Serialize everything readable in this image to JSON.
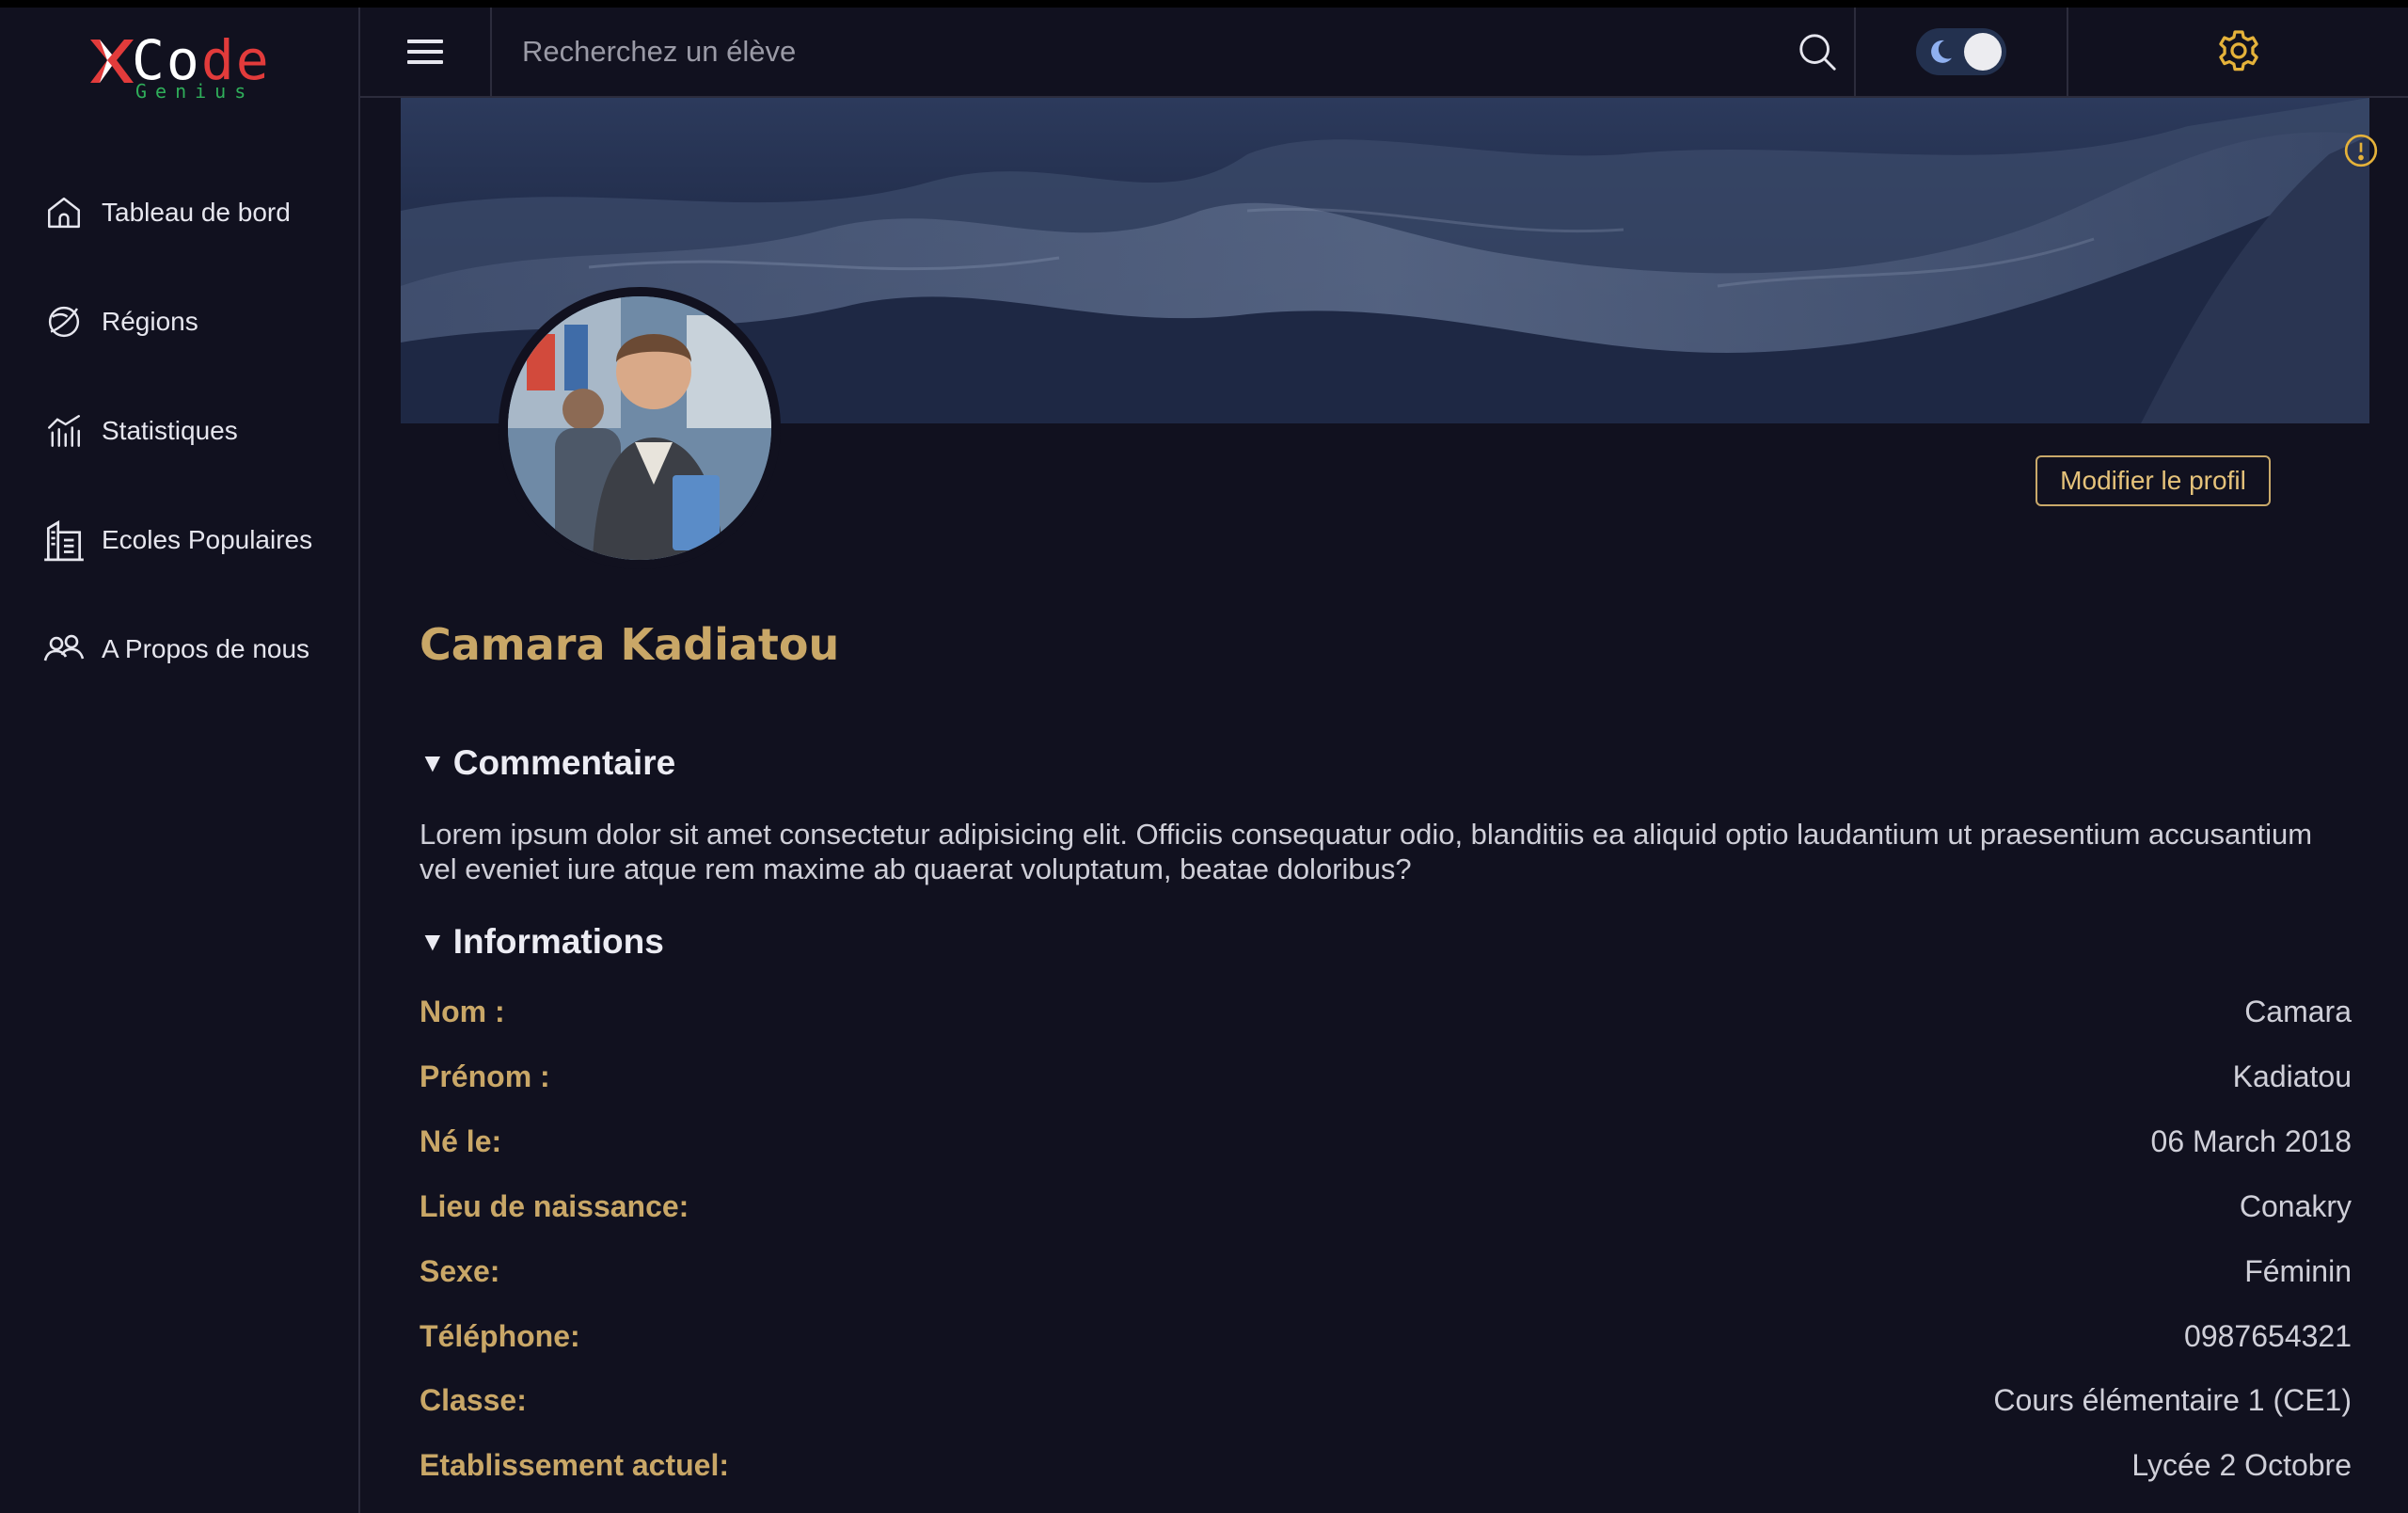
{
  "app": {
    "logo_main": "Code",
    "logo_sub": "Genius"
  },
  "sidebar": {
    "items": [
      {
        "label": "Tableau de bord",
        "icon": "home-icon"
      },
      {
        "label": "Régions",
        "icon": "globe-icon"
      },
      {
        "label": "Statistiques",
        "icon": "chart-icon"
      },
      {
        "label": "Ecoles Populaires",
        "icon": "building-icon"
      },
      {
        "label": "A Propos de nous",
        "icon": "users-icon"
      }
    ]
  },
  "header": {
    "search_placeholder": "Recherchez un élève",
    "theme": "dark",
    "icons": [
      "menu-icon",
      "search-icon",
      "moon-icon",
      "gear-icon"
    ]
  },
  "profile": {
    "name": "Camara Kadiatou",
    "edit_label": "Modifier le profil",
    "comment_title": "Commentaire",
    "comment_text": "Lorem ipsum dolor sit amet consectetur adipisicing elit. Officiis consequatur odio, blanditiis ea aliquid optio laudantium ut praesentium accusantium vel eveniet iure atque rem maxime ab quaerat voluptatum, beatae doloribus?",
    "info_title": "Informations",
    "fields": [
      {
        "label": "Nom :",
        "value": "Camara"
      },
      {
        "label": "Prénom :",
        "value": "Kadiatou"
      },
      {
        "label": "Né le:",
        "value": "06 March 2018"
      },
      {
        "label": "Lieu de naissance:",
        "value": "Conakry"
      },
      {
        "label": "Sexe:",
        "value": "Féminin"
      },
      {
        "label": "Téléphone:",
        "value": "0987654321"
      },
      {
        "label": "Classe:",
        "value": "Cours élémentaire 1 (CE1)"
      },
      {
        "label": "Etablissement actuel:",
        "value": "Lycée 2 Octobre"
      }
    ]
  },
  "colors": {
    "background": "#11111f",
    "accent_gold": "#c9a767",
    "logo_red": "#e23b3b",
    "logo_green": "#2fae5a"
  }
}
